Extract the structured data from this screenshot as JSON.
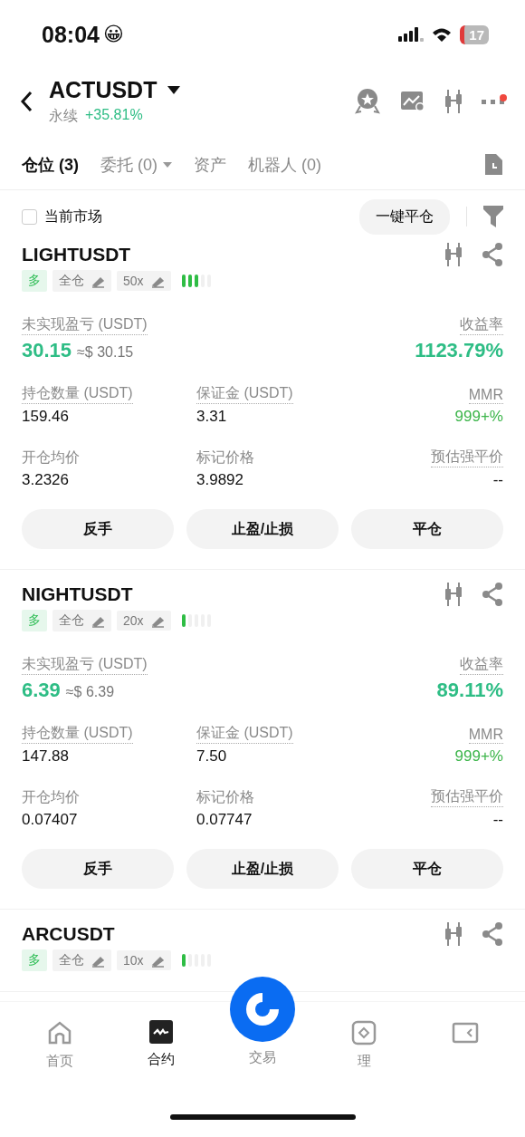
{
  "status_bar": {
    "time": "08:04",
    "emoji": "😀",
    "battery": "17"
  },
  "header": {
    "symbol": "ACTUSDT",
    "subtitle": "永续",
    "change": "+35.81%",
    "notification_dot": true
  },
  "tabs": [
    {
      "label": "仓位 (3)",
      "selected": true,
      "dropdown": false
    },
    {
      "label": "委托 (0)",
      "selected": false,
      "dropdown": true
    },
    {
      "label": "资产",
      "selected": false,
      "dropdown": false
    },
    {
      "label": "机器人 (0)",
      "selected": false,
      "dropdown": false
    }
  ],
  "filter": {
    "label": "当前市场",
    "checked": false,
    "close_all": "一键平仓"
  },
  "positions": [
    {
      "symbol": "LIGHTUSDT",
      "side": "多",
      "margin_mode": "全仓",
      "leverage": "50x",
      "risk_bars": [
        {
          "on": true
        },
        {
          "on": true
        },
        {
          "on": true
        },
        {
          "on": false
        },
        {
          "on": false
        }
      ],
      "pnl_label": "未实现盈亏 (USDT)",
      "pnl": "30.15",
      "pnl_approx": "≈$ 30.15",
      "roe_label": "收益率",
      "roe": "1123.79%",
      "fields": [
        {
          "label": "持仓数量 (USDT)",
          "value": "159.46",
          "dotted": true
        },
        {
          "label": "保证金 (USDT)",
          "value": "3.31",
          "dotted": true
        },
        {
          "label": "MMR",
          "value": "999+%",
          "dotted": true
        },
        {
          "label": "开仓均价",
          "value": "3.2326",
          "dotted": false
        },
        {
          "label": "标记价格",
          "value": "3.9892",
          "dotted": false
        },
        {
          "label": "预估强平价",
          "value": "--",
          "dotted": true
        }
      ],
      "buttons": [
        "反手",
        "止盈/止损",
        "平仓"
      ]
    },
    {
      "symbol": "NIGHTUSDT",
      "side": "多",
      "margin_mode": "全仓",
      "leverage": "20x",
      "risk_bars": [
        {
          "on": true
        },
        {
          "on": false
        },
        {
          "on": false
        },
        {
          "on": false
        },
        {
          "on": false
        }
      ],
      "pnl_label": "未实现盈亏 (USDT)",
      "pnl": "6.39",
      "pnl_approx": "≈$ 6.39",
      "roe_label": "收益率",
      "roe": "89.11%",
      "fields": [
        {
          "label": "持仓数量 (USDT)",
          "value": "147.88",
          "dotted": true
        },
        {
          "label": "保证金 (USDT)",
          "value": "7.50",
          "dotted": true
        },
        {
          "label": "MMR",
          "value": "999+%",
          "dotted": true
        },
        {
          "label": "开仓均价",
          "value": "0.07407",
          "dotted": false
        },
        {
          "label": "标记价格",
          "value": "0.07747",
          "dotted": false
        },
        {
          "label": "预估强平价",
          "value": "--",
          "dotted": true
        }
      ],
      "buttons": [
        "反手",
        "止盈/止损",
        "平仓"
      ]
    },
    {
      "symbol": "ARCUSDT",
      "side": "多",
      "margin_mode": "全仓",
      "leverage": "10x",
      "risk_bars": [
        {
          "on": true
        },
        {
          "on": false
        },
        {
          "on": false
        },
        {
          "on": false
        },
        {
          "on": false
        }
      ]
    }
  ],
  "bottom_nav": [
    {
      "kind": "home",
      "label": "首页",
      "selected": false
    },
    {
      "kind": "futures",
      "label": "合约",
      "selected": true
    },
    {
      "kind": "trade",
      "label": "交易",
      "selected": false
    },
    {
      "kind": "earn",
      "label": "理",
      "selected": false
    },
    {
      "kind": "wallet",
      "selected": false
    }
  ]
}
